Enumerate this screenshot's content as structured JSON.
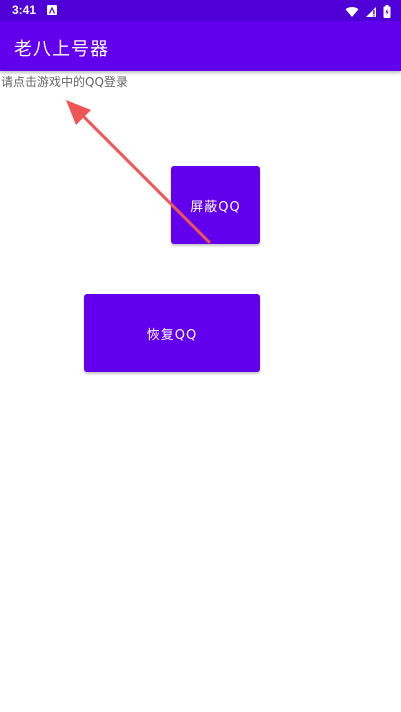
{
  "status_bar": {
    "time": "3:41",
    "icons": [
      "app-notification-icon",
      "wifi-icon",
      "signal-icon",
      "battery-icon"
    ]
  },
  "app_bar": {
    "title": "老八上号器"
  },
  "content": {
    "hint": "请点击游戏中的QQ登录",
    "block_button_label": "屏蔽QQ",
    "restore_button_label": "恢复QQ"
  },
  "colors": {
    "status_bar": "#4e00d6",
    "primary": "#6200ee",
    "annotation_arrow": "#f05555"
  }
}
